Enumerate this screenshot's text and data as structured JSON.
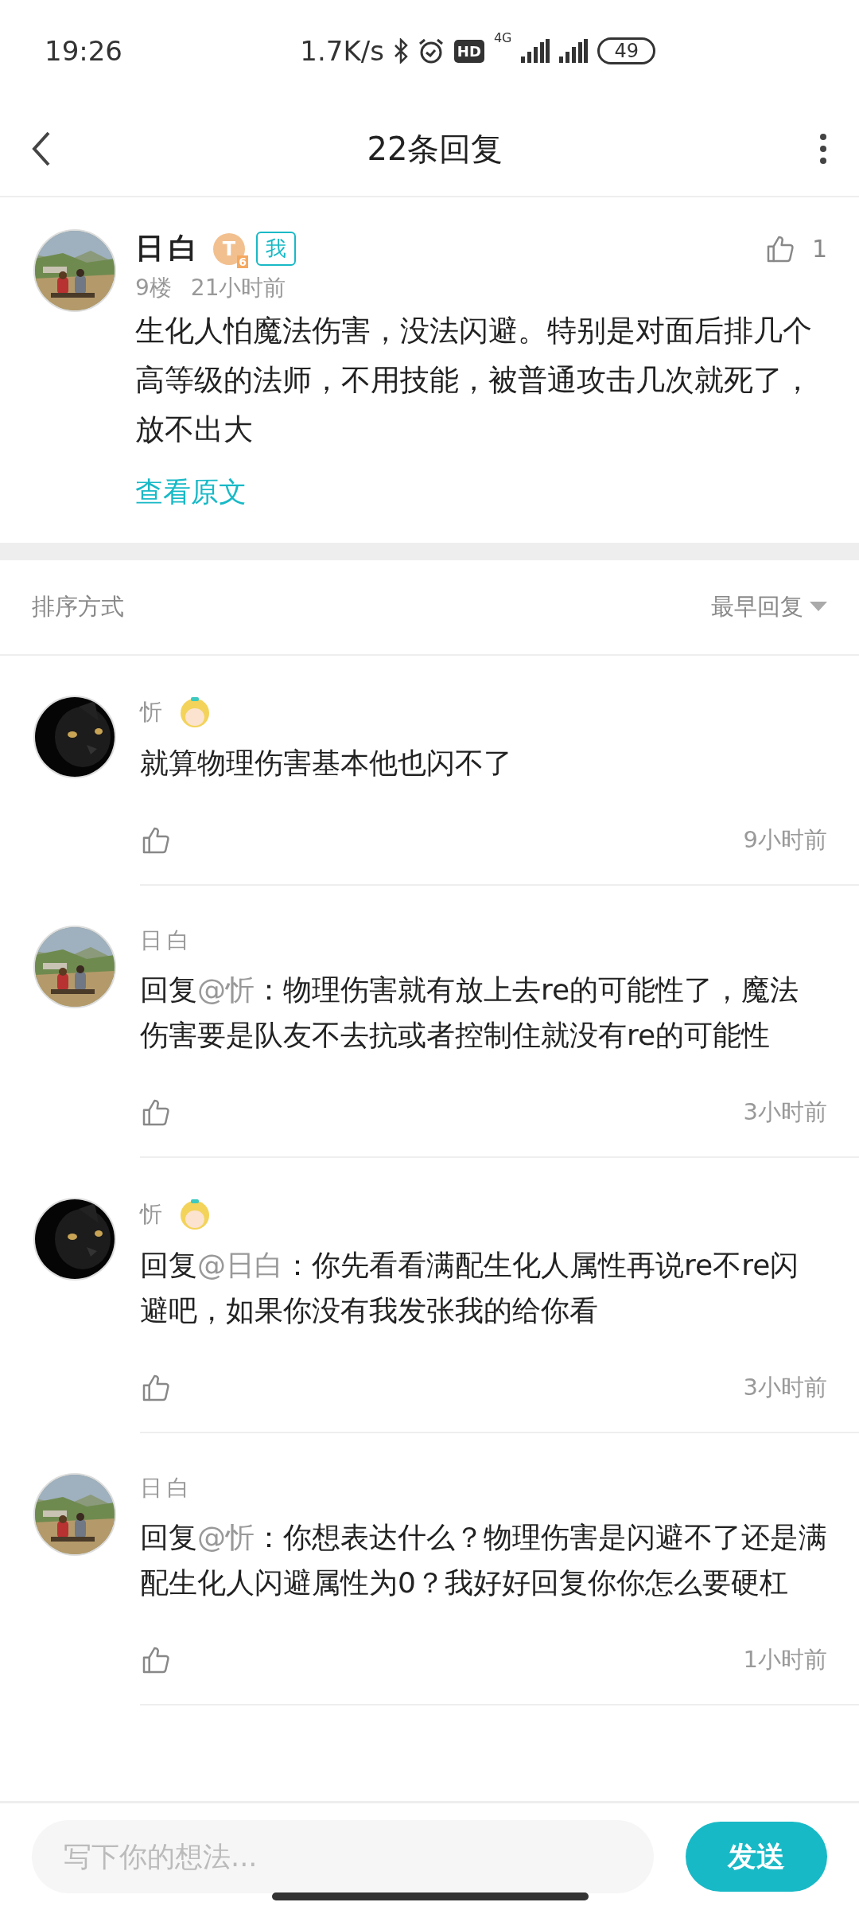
{
  "status_bar": {
    "time": "19:26",
    "speed": "1.7K/s",
    "network": "4G",
    "hd": "HD",
    "battery": "49"
  },
  "header": {
    "title": "22条回复"
  },
  "comment": {
    "author": "日白",
    "level_badge": "T",
    "level_num": "6",
    "owner_tag": "我",
    "floor": "9楼",
    "time": "21小时前",
    "likes": "1",
    "text": "生化人怕魔法伤害，没法闪避。特别是对面后排几个高等级的法师，不用技能，被普通攻击几次就死了，放不出大",
    "view_original": "查看原文"
  },
  "sort": {
    "label": "排序方式",
    "value": "最早回复"
  },
  "replies": [
    {
      "author": "忻",
      "sticker": true,
      "text": "就算物理伤害基本他也闪不了",
      "time": "9小时前"
    },
    {
      "author": "日白",
      "sticker": false,
      "prefix": "回复",
      "reply_to": "@忻",
      "text": "：物理伤害就有放上去re的可能性了，魔法伤害要是队友不去抗或者控制住就没有re的可能性",
      "time": "3小时前"
    },
    {
      "author": "忻",
      "sticker": true,
      "prefix": "回复",
      "reply_to": "@日白",
      "text": "：你先看看满配生化人属性再说re不re闪避吧，如果你没有我发张我的给你看",
      "time": "3小时前"
    },
    {
      "author": "日白",
      "sticker": false,
      "prefix": "回复",
      "reply_to": "@忻",
      "text": "：你想表达什么？物理伤害是闪避不了还是满配生化人闪避属性为0？我好好回复你你怎么要硬杠",
      "time": "1小时前"
    }
  ],
  "composer": {
    "placeholder": "写下你的想法...",
    "send": "发送"
  }
}
